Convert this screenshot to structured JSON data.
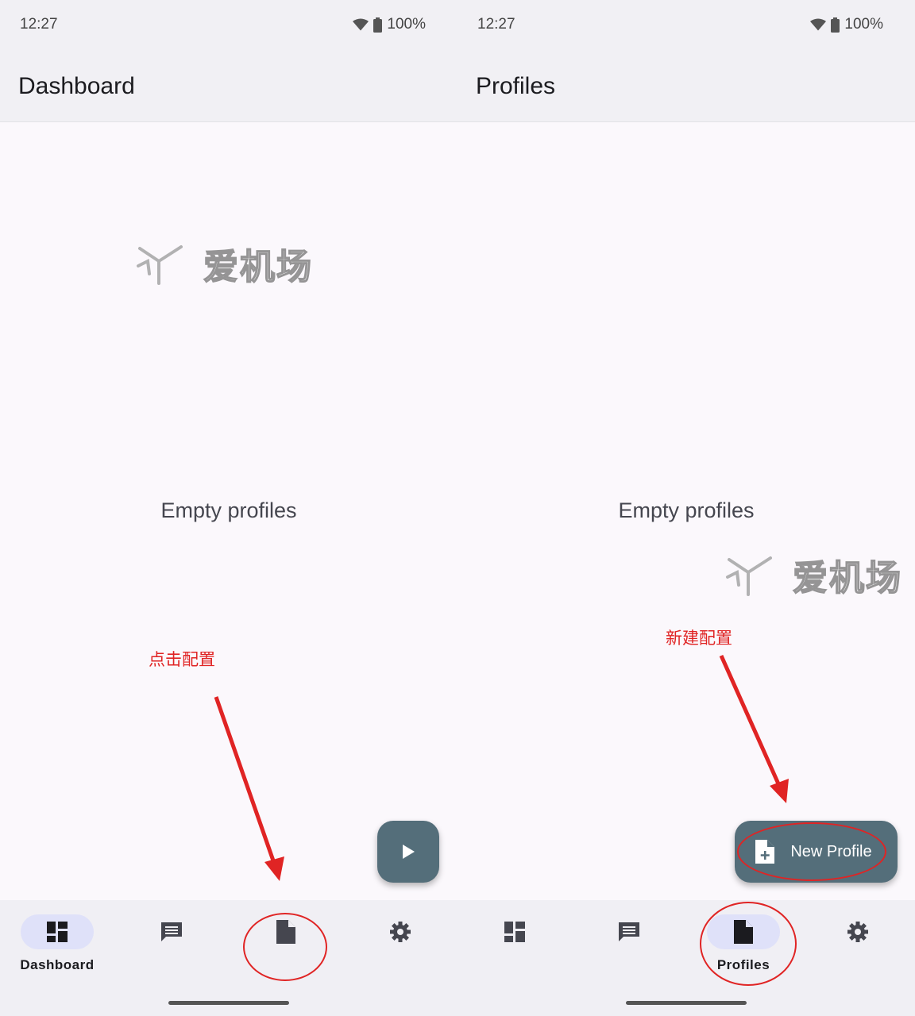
{
  "status": {
    "time": "12:27",
    "battery": "100%"
  },
  "screens": {
    "left": {
      "title": "Dashboard",
      "empty_text": "Empty profiles",
      "annotation": "点击配置",
      "nav": [
        "Dashboard",
        "",
        "",
        ""
      ]
    },
    "right": {
      "title": "Profiles",
      "empty_text": "Empty profiles",
      "annotation": "新建配置",
      "fab_label": "New Profile",
      "nav": [
        "",
        "",
        "Profiles",
        ""
      ]
    }
  },
  "watermark": "爱机场",
  "icons": {
    "dashboard": "dashboard-icon",
    "messages": "message-icon",
    "profiles": "profile-file-icon",
    "settings": "gear-icon",
    "play": "play-icon",
    "new_profile": "note-add-icon"
  },
  "colors": {
    "accent": "#546e7a",
    "nav_active": "#dfe1f9",
    "annotation": "#e02424"
  }
}
